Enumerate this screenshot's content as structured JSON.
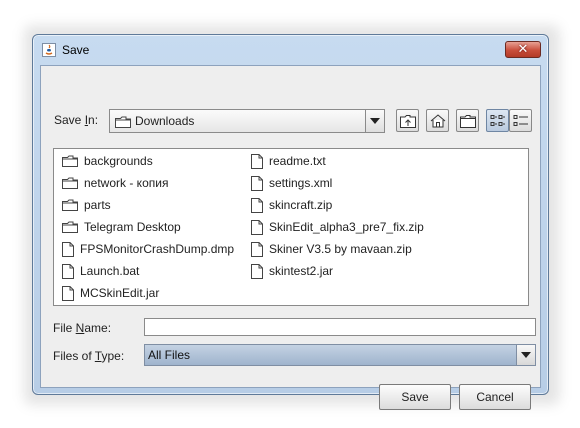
{
  "window": {
    "title": "Save"
  },
  "save_in": {
    "label_prefix": "Save ",
    "label_mnemonic": "I",
    "label_suffix": "n:",
    "selected": "Downloads"
  },
  "toolbar": {
    "buttons": [
      {
        "name": "up-one-level-icon"
      },
      {
        "name": "home-icon"
      },
      {
        "name": "new-folder-icon"
      },
      {
        "name": "list-view-icon",
        "active": true
      },
      {
        "name": "details-view-icon"
      }
    ]
  },
  "files": {
    "column1": [
      {
        "name": "backgrounds",
        "kind": "folder"
      },
      {
        "name": "network - копия",
        "kind": "folder"
      },
      {
        "name": "parts",
        "kind": "folder"
      },
      {
        "name": "Telegram Desktop",
        "kind": "folder"
      },
      {
        "name": "FPSMonitorCrashDump.dmp",
        "kind": "file"
      },
      {
        "name": "Launch.bat",
        "kind": "file"
      },
      {
        "name": "MCSkinEdit.jar",
        "kind": "file"
      }
    ],
    "column2": [
      {
        "name": "readme.txt",
        "kind": "file"
      },
      {
        "name": "settings.xml",
        "kind": "file"
      },
      {
        "name": "skincraft.zip",
        "kind": "file"
      },
      {
        "name": "SkinEdit_alpha3_pre7_fix.zip",
        "kind": "file"
      },
      {
        "name": "Skiner V3.5 by mavaan.zip",
        "kind": "file"
      },
      {
        "name": "skintest2.jar",
        "kind": "file"
      }
    ]
  },
  "file_name": {
    "label_prefix": "File ",
    "label_mnemonic": "N",
    "label_suffix": "ame:",
    "value": ""
  },
  "file_type": {
    "label_prefix": "Files of ",
    "label_mnemonic": "T",
    "label_suffix": "ype:",
    "selected": "All Files"
  },
  "actions": {
    "save": "Save",
    "cancel": "Cancel"
  }
}
